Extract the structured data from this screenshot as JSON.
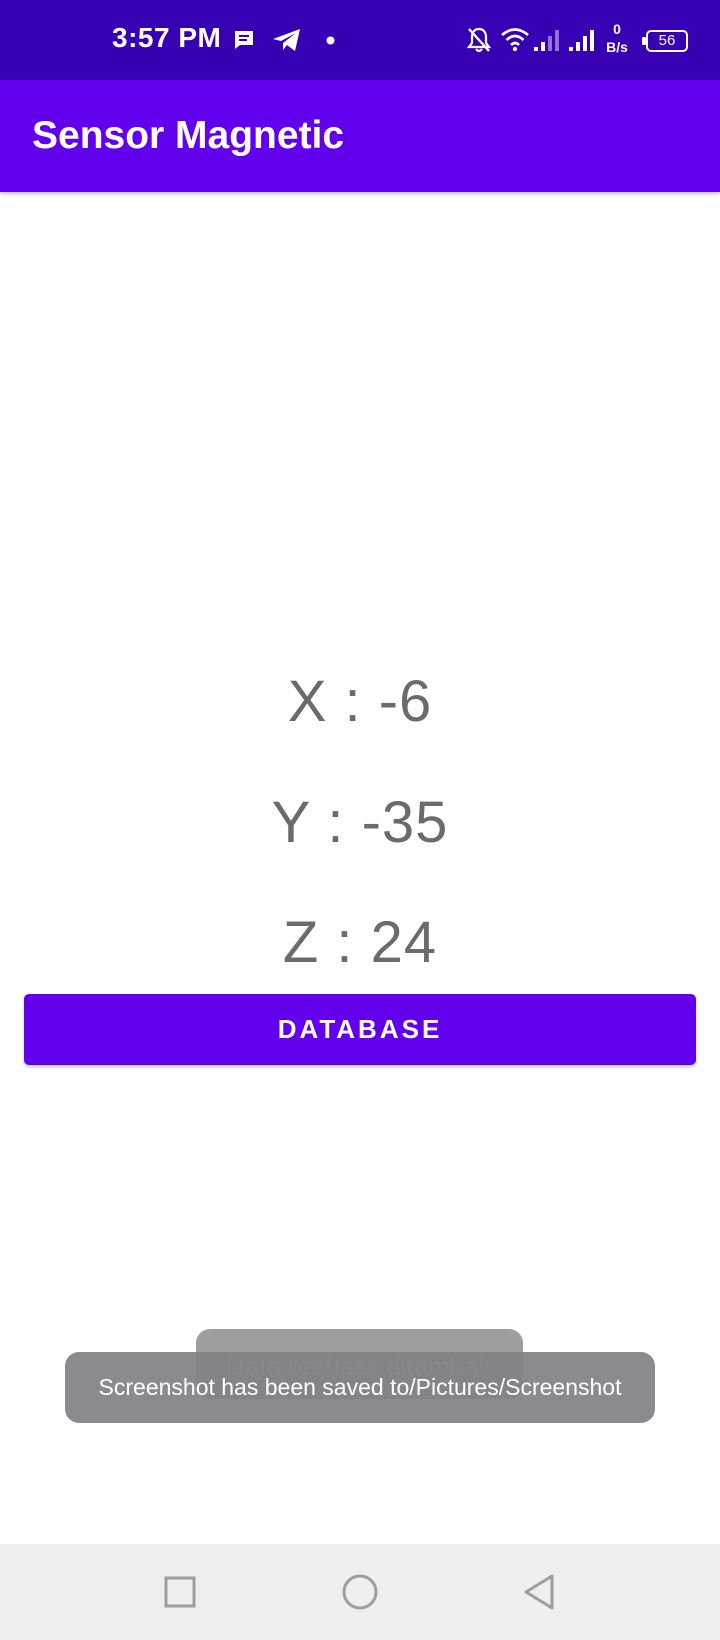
{
  "status_bar": {
    "time": "3:57 PM",
    "notification_icons": [
      "message-icon",
      "telegram-icon",
      "dot-icon"
    ],
    "system_icons": [
      "bell-off-icon",
      "wifi-icon",
      "signal-icon",
      "signal-icon"
    ],
    "net_speed_value": "0",
    "net_speed_unit": "B/s",
    "battery_level": "56"
  },
  "app_bar": {
    "title": "Sensor Magnetic"
  },
  "readings": {
    "x": "X : -6",
    "y": "Y : -35",
    "z": "Z : 24"
  },
  "button": {
    "label": "DATABASE"
  },
  "toasts": {
    "data_added": "Data berhasil ditambah",
    "screenshot_saved": "Screenshot has been saved to/Pictures/Screenshot"
  },
  "nav_bar": {
    "buttons": [
      "recents-icon",
      "home-icon",
      "back-icon"
    ]
  },
  "colors": {
    "status_bar": "#3700b3",
    "primary": "#6200ee",
    "reading_text": "#6b6b6b",
    "nav_bar": "#efefef"
  }
}
